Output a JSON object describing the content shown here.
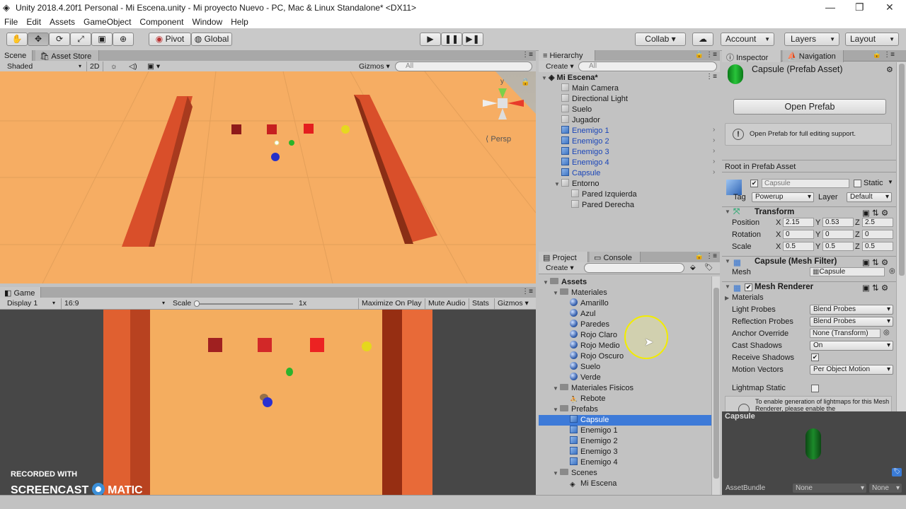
{
  "window": {
    "title": "Unity 2018.4.20f1 Personal - Mi Escena.unity - Mi proyecto Nuevo - PC, Mac & Linux Standalone* <DX11>",
    "min": "—",
    "max": "❐",
    "close": "✕"
  },
  "menu": [
    "File",
    "Edit",
    "Assets",
    "GameObject",
    "Component",
    "Window",
    "Help"
  ],
  "toolbar": {
    "pivot": "Pivot",
    "global": "Global",
    "collab": "Collab ▾",
    "account": "Account",
    "layers": "Layers",
    "layout": "Layout"
  },
  "scene": {
    "tab": "Scene",
    "asset_store": "Asset Store",
    "shaded": "Shaded",
    "mode2d": "2D",
    "gizmos": "Gizmos",
    "search": "All",
    "persp": "Persp",
    "gizmo_y": "y"
  },
  "game": {
    "tab": "Game",
    "display": "Display 1",
    "aspect": "16:9",
    "scale": "Scale",
    "scale_val": "1x",
    "maximize": "Maximize On Play",
    "mute": "Mute Audio",
    "stats": "Stats",
    "gizmos": "Gizmos"
  },
  "hierarchy": {
    "tab": "Hierarchy",
    "create": "Create",
    "search": "All",
    "scene_name": "Mi Escena*",
    "items": [
      {
        "label": "Main Camera",
        "indent": 1,
        "blue": false,
        "arrow": false
      },
      {
        "label": "Directional Light",
        "indent": 1,
        "blue": false,
        "arrow": false
      },
      {
        "label": "Suelo",
        "indent": 1,
        "blue": false,
        "arrow": false
      },
      {
        "label": "Jugador",
        "indent": 1,
        "blue": false,
        "arrow": false
      },
      {
        "label": "Enemigo 1",
        "indent": 1,
        "blue": true,
        "arrow": true
      },
      {
        "label": "Enemigo 2",
        "indent": 1,
        "blue": true,
        "arrow": true
      },
      {
        "label": "Enemigo 3",
        "indent": 1,
        "blue": true,
        "arrow": true
      },
      {
        "label": "Enemigo 4",
        "indent": 1,
        "blue": true,
        "arrow": true
      },
      {
        "label": "Capsule",
        "indent": 1,
        "blue": true,
        "arrow": true
      },
      {
        "label": "Entorno",
        "indent": 1,
        "blue": false,
        "arrow": false,
        "expanded": true
      },
      {
        "label": "Pared Izquierda",
        "indent": 2,
        "blue": false,
        "arrow": false
      },
      {
        "label": "Pared Derecha",
        "indent": 2,
        "blue": false,
        "arrow": false
      }
    ]
  },
  "project": {
    "tab": "Project",
    "console": "Console",
    "create": "Create",
    "items": [
      {
        "label": "Assets",
        "indent": 0,
        "type": "root"
      },
      {
        "label": "Materiales",
        "indent": 1,
        "type": "folder"
      },
      {
        "label": "Amarillo",
        "indent": 2,
        "type": "mat"
      },
      {
        "label": "Azul",
        "indent": 2,
        "type": "mat"
      },
      {
        "label": "Paredes",
        "indent": 2,
        "type": "mat"
      },
      {
        "label": "Rojo Claro",
        "indent": 2,
        "type": "mat"
      },
      {
        "label": "Rojo Medio",
        "indent": 2,
        "type": "mat"
      },
      {
        "label": "Rojo Oscuro",
        "indent": 2,
        "type": "mat"
      },
      {
        "label": "Suelo",
        "indent": 2,
        "type": "mat"
      },
      {
        "label": "Verde",
        "indent": 2,
        "type": "mat"
      },
      {
        "label": "Materiales Fisicos",
        "indent": 1,
        "type": "folder"
      },
      {
        "label": "Rebote",
        "indent": 2,
        "type": "phys"
      },
      {
        "label": "Prefabs",
        "indent": 1,
        "type": "folder"
      },
      {
        "label": "Capsule",
        "indent": 2,
        "type": "prefab",
        "selected": true
      },
      {
        "label": "Enemigo 1",
        "indent": 2,
        "type": "prefab"
      },
      {
        "label": "Enemigo 2",
        "indent": 2,
        "type": "prefab"
      },
      {
        "label": "Enemigo 3",
        "indent": 2,
        "type": "prefab"
      },
      {
        "label": "Enemigo 4",
        "indent": 2,
        "type": "prefab"
      },
      {
        "label": "Scenes",
        "indent": 1,
        "type": "folder"
      },
      {
        "label": "Mi Escena",
        "indent": 2,
        "type": "unity"
      }
    ]
  },
  "inspector": {
    "tab": "Inspector",
    "nav": "Navigation",
    "asset_title": "Capsule (Prefab Asset)",
    "open_prefab": "Open Prefab",
    "open_info": "Open Prefab for full editing support.",
    "root": "Root in Prefab Asset",
    "name": "Capsule",
    "static": "Static",
    "tag_label": "Tag",
    "tag": "Powerup",
    "layer_label": "Layer",
    "layer": "Default",
    "transform": "Transform",
    "position": "Position",
    "rotation": "Rotation",
    "scale": "Scale",
    "pos": [
      "2.15",
      "0.53",
      "2.5"
    ],
    "rot": [
      "0",
      "0",
      "0"
    ],
    "scl": [
      "0.5",
      "0.5",
      "0.5"
    ],
    "mesh_filter": "Capsule (Mesh Filter)",
    "mesh_label": "Mesh",
    "mesh": "Capsule",
    "mesh_renderer": "Mesh Renderer",
    "materials": "Materials",
    "light_probes": "Light Probes",
    "light_probes_v": "Blend Probes",
    "refl_probes": "Reflection Probes",
    "refl_probes_v": "Blend Probes",
    "anchor": "Anchor Override",
    "anchor_v": "None (Transform)",
    "cast": "Cast Shadows",
    "cast_v": "On",
    "receive": "Receive Shadows",
    "motion": "Motion Vectors",
    "motion_v": "Per Object Motion",
    "lightmap": "Lightmap Static",
    "lightmap_info": "To enable generation of lightmaps for this Mesh Renderer, please enable the",
    "preview_title": "Capsule",
    "assetbundle": "AssetBundle",
    "ab_v": "None",
    "ab_v2": "None"
  },
  "watermark": {
    "line1": "RECORDED WITH",
    "line2a": "SCREENCAST",
    "line2b": "MATIC"
  },
  "colors": {
    "selection": "#3d7ad8",
    "floor": "#f4a85c",
    "wall": "#d9502a",
    "blue_text": "#1a45b8"
  }
}
